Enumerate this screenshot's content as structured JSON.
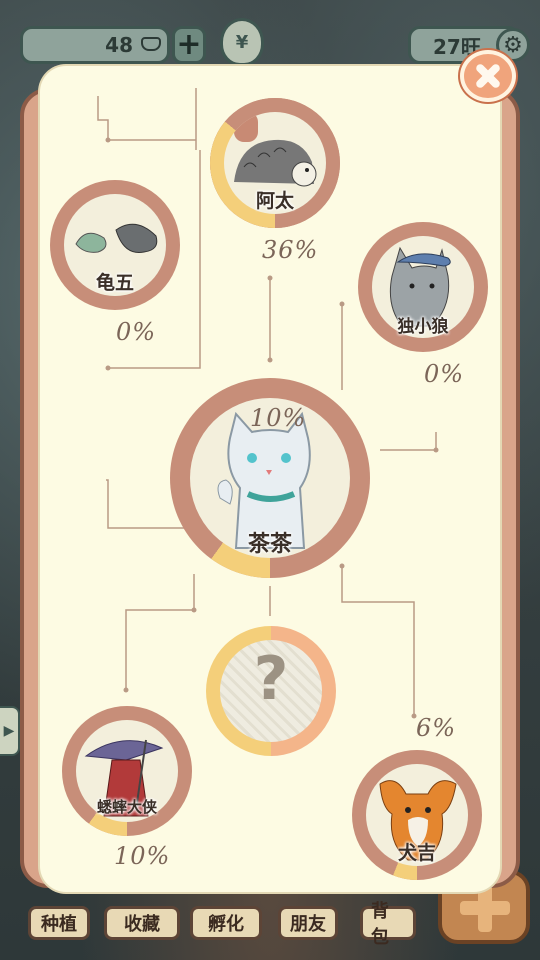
{
  "topbar": {
    "coins": "48",
    "coin_icon": "ingot-icon",
    "add_icon": "plus-icon",
    "bag_label": "¥",
    "energy": "27旺",
    "settings_icon": "gear-icon"
  },
  "panel": {
    "close_icon": "close-icon",
    "center": {
      "name": "茶茶",
      "percent": "10%"
    },
    "nodes": [
      {
        "name": "阿太",
        "percent": "36%"
      },
      {
        "name": "龟五",
        "percent": "0%"
      },
      {
        "name": "独小狼",
        "percent": "0%"
      },
      {
        "name": "蟋蟀大侠",
        "percent": "10%"
      },
      {
        "name": "犬吉",
        "percent": "6%"
      }
    ],
    "unknown": {
      "label": "?"
    }
  },
  "bottom_nav": {
    "plant": "种植",
    "collection": "收藏",
    "hatch": "孵化",
    "friends": "朋友",
    "backpack": "背包"
  },
  "colors": {
    "panel_bg": "#fdfbe3",
    "node_ring": "#c78e79",
    "progress": "#f4cf7a",
    "close": "#f0a47c"
  }
}
